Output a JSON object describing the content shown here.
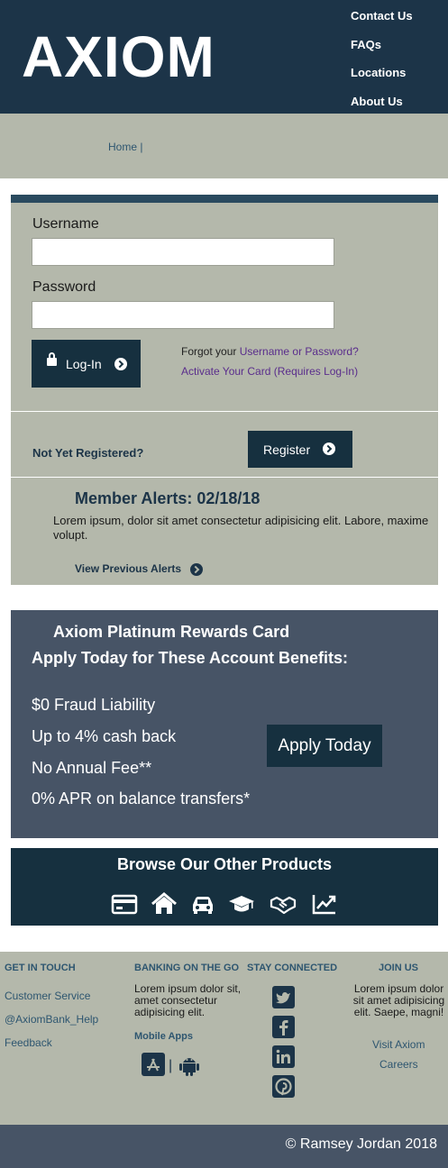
{
  "header": {
    "logo": "AXIOM",
    "nav": [
      "Contact Us",
      "FAQs",
      "Locations",
      "About Us"
    ]
  },
  "breadcrumb": "Home |",
  "login": {
    "username_label": "Username",
    "password_label": "Password",
    "username_value": "",
    "password_value": "",
    "login_label": "Log-In",
    "forgot_prefix": "Forgot your ",
    "forgot_link": "Username or Password?",
    "activate_link": "Activate Your Card (Requires Log-In)",
    "not_registered": "Not Yet Registered?",
    "register_label": "Register"
  },
  "alerts": {
    "title": "Member Alerts: 02/18/18",
    "text": "Lorem ipsum, dolor sit amet consectetur adipisicing elit. Labore, maxime volupt.",
    "view_previous": "View Previous Alerts"
  },
  "rewards": {
    "title": "Axiom Platinum Rewards Card",
    "subtitle": "Apply Today for These Account Benefits:",
    "benefits": [
      "$0 Fraud Liability",
      "Up to 4% cash back",
      "No Annual Fee**",
      "0% APR on balance transfers*"
    ],
    "apply_label": "Apply Today"
  },
  "products": {
    "title": "Browse Our Other Products",
    "icons": [
      "credit-card-icon",
      "home-icon",
      "car-icon",
      "graduation-cap-icon",
      "handshake-icon",
      "chart-line-icon"
    ]
  },
  "footer": {
    "get_in_touch": {
      "heading": "GET IN TOUCH",
      "links": [
        "Customer Service",
        "@AxiomBank_Help",
        "Feedback"
      ]
    },
    "banking": {
      "heading": "BANKING ON THE GO",
      "text": "Lorem ipsum dolor sit, amet consectetur adipisicing elit.",
      "mobile_label": "Mobile Apps",
      "separator": "|"
    },
    "stay_connected": {
      "heading": "STAY CONNECTED",
      "icons": [
        "twitter-icon",
        "facebook-icon",
        "linkedin-icon",
        "pinterest-icon"
      ]
    },
    "join_us": {
      "heading": "JOIN US",
      "text": "Lorem ipsum dolor sit amet adipisicing elit. Saepe, magni!",
      "links": [
        "Visit Axiom",
        "Careers"
      ]
    }
  },
  "copyright": "© Ramsey Jordan 2018",
  "colors": {
    "navy": "#1c3448",
    "dark_button": "#16303f",
    "sage": "#b4b8ab",
    "slate": "#475466",
    "link_purple": "#5a2d8c"
  }
}
